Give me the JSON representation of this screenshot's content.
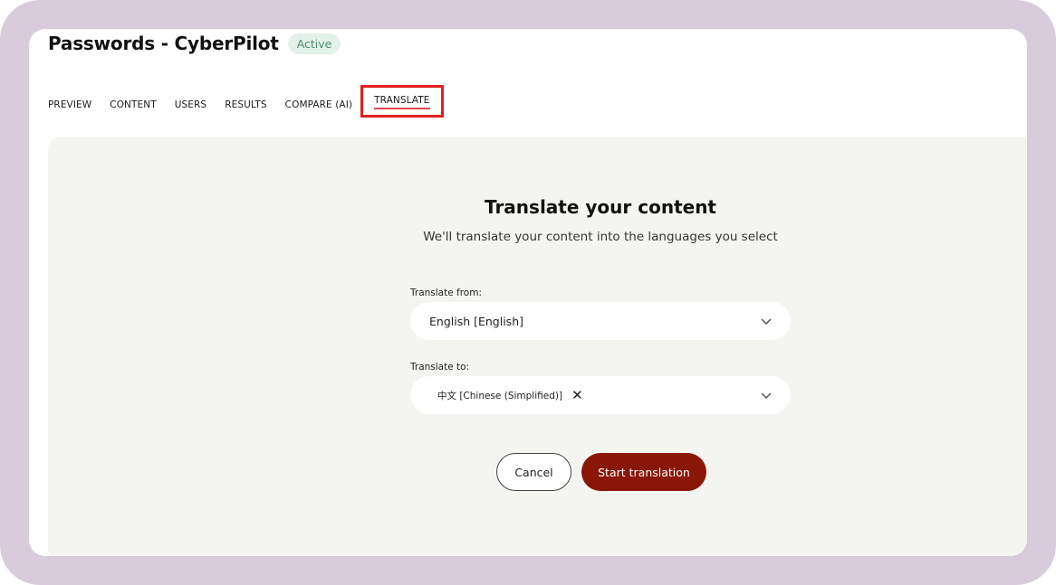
{
  "page": {
    "title": "Passwords - CyberPilot",
    "status_badge": "Active"
  },
  "tabs": [
    {
      "label": "PREVIEW"
    },
    {
      "label": "CONTENT"
    },
    {
      "label": "USERS"
    },
    {
      "label": "RESULTS"
    },
    {
      "label": "COMPARE (AI)"
    },
    {
      "label": "TRANSLATE",
      "active": true
    }
  ],
  "translate": {
    "heading": "Translate your content",
    "subheading": "We'll translate your content into the languages you select",
    "from_label": "Translate from:",
    "from_value": "English [English]",
    "to_label": "Translate to:",
    "to_values": [
      "中文 [Chinese (Simplified)]"
    ],
    "remove_glyph": "✕",
    "cancel_label": "Cancel",
    "start_label": "Start translation"
  },
  "colors": {
    "frame": "#d8cbdb",
    "panel": "#f4f4f1",
    "active_badge_bg": "#e4f1ea",
    "active_badge_text": "#4d8a6c",
    "highlight": "#e0201f",
    "primary_button": "#8a1607"
  },
  "icons": {
    "dropdown": "chevron-down-icon",
    "remove": "close-icon"
  }
}
